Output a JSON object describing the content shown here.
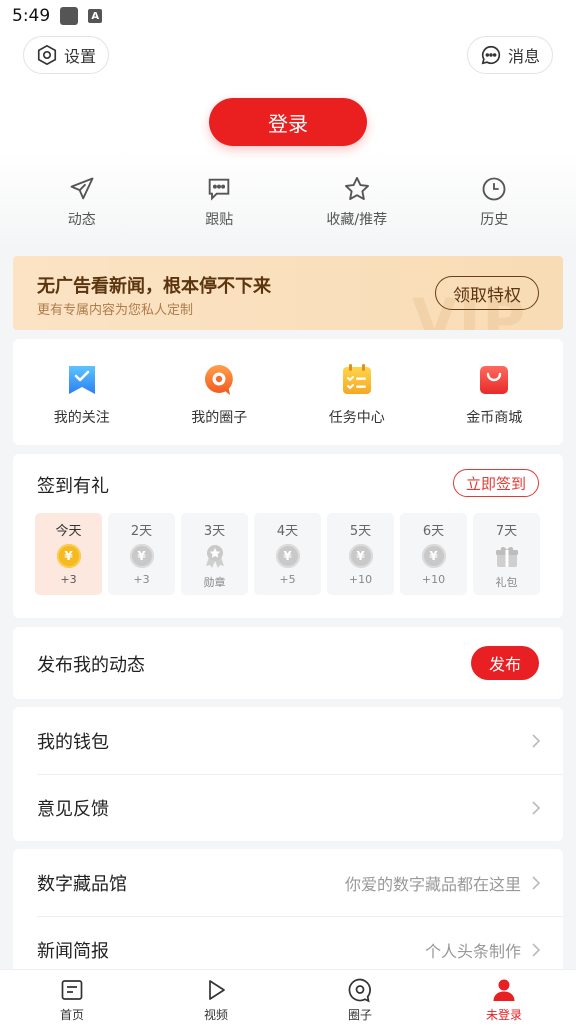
{
  "status_bar": {
    "time": "5:49",
    "app_indicator": "A"
  },
  "header": {
    "settings_label": "设置",
    "messages_label": "消息"
  },
  "login": {
    "label": "登录"
  },
  "quick_actions": [
    {
      "label": "动态",
      "icon": "send-icon"
    },
    {
      "label": "跟贴",
      "icon": "comment-icon"
    },
    {
      "label": "收藏/推荐",
      "icon": "star-icon"
    },
    {
      "label": "历史",
      "icon": "clock-icon"
    }
  ],
  "vip_banner": {
    "title": "无广告看新闻，根本停不下来",
    "subtitle": "更有专属内容为您私人定制",
    "claim_label": "领取特权",
    "watermark": "VIP"
  },
  "features": [
    {
      "label": "我的关注",
      "icon": "bookmark-icon"
    },
    {
      "label": "我的圈子",
      "icon": "circle-chat-icon"
    },
    {
      "label": "任务中心",
      "icon": "task-list-icon"
    },
    {
      "label": "金币商城",
      "icon": "shopping-bag-icon"
    }
  ],
  "signin": {
    "title": "签到有礼",
    "button_label": "立即签到",
    "coin_symbol": "¥",
    "days": [
      {
        "day": "今天",
        "reward": "+3",
        "icon": "gold-coin-icon"
      },
      {
        "day": "2天",
        "reward": "+3",
        "icon": "coin-icon"
      },
      {
        "day": "3天",
        "reward": "勋章",
        "icon": "medal-icon"
      },
      {
        "day": "4天",
        "reward": "+5",
        "icon": "coin-icon"
      },
      {
        "day": "5天",
        "reward": "+10",
        "icon": "coin-icon"
      },
      {
        "day": "6天",
        "reward": "+10",
        "icon": "coin-icon"
      },
      {
        "day": "7天",
        "reward": "礼包",
        "icon": "gift-icon"
      }
    ]
  },
  "publish": {
    "label": "发布我的动态",
    "button_label": "发布"
  },
  "wallet_section": [
    {
      "label": "我的钱包",
      "hint": ""
    },
    {
      "label": "意见反馈",
      "hint": ""
    }
  ],
  "digital_section": [
    {
      "label": "数字藏品馆",
      "hint": "你爱的数字藏品都在这里"
    },
    {
      "label": "新闻简报",
      "hint": "个人头条制作"
    }
  ],
  "tab_bar": [
    {
      "label": "首页",
      "icon": "news-icon"
    },
    {
      "label": "视频",
      "icon": "play-icon"
    },
    {
      "label": "圈子",
      "icon": "circle-icon"
    },
    {
      "label": "未登录",
      "icon": "user-icon"
    }
  ],
  "colors": {
    "accent": "#e81f23",
    "vip_text": "#5b3410",
    "vip_bg": "#fbe3c4"
  }
}
